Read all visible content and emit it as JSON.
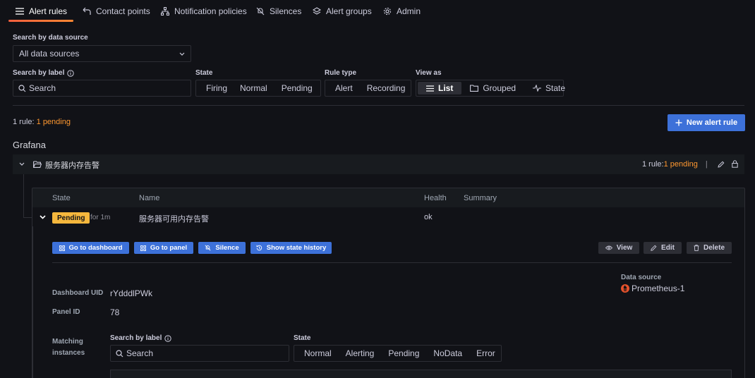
{
  "tabs": [
    {
      "label": "Alert rules",
      "icon": "list-icon",
      "active": true
    },
    {
      "label": "Contact points",
      "icon": "comment-icon"
    },
    {
      "label": "Notification policies",
      "icon": "sitemap-icon"
    },
    {
      "label": "Silences",
      "icon": "bell-slash-icon"
    },
    {
      "label": "Alert groups",
      "icon": "layers-icon"
    },
    {
      "label": "Admin",
      "icon": "cog-icon"
    }
  ],
  "filters": {
    "datasource_label": "Search by data source",
    "datasource_value": "All data sources",
    "label_search_label": "Search by label",
    "label_search_placeholder": "Search",
    "state_label": "State",
    "state_options": [
      "Firing",
      "Normal",
      "Pending"
    ],
    "ruletype_label": "Rule type",
    "ruletype_options": [
      "Alert",
      "Recording"
    ],
    "viewas_label": "View as",
    "viewas_options": [
      "List",
      "Grouped",
      "State"
    ],
    "viewas_selected": "List"
  },
  "summary": {
    "prefix": "1 rule: ",
    "pending": "1 pending"
  },
  "new_rule_button": "New alert rule",
  "namespace": "Grafana",
  "folder": {
    "name": "服务器内存告警",
    "summary_prefix": "1 rule: ",
    "summary_pending": "1 pending",
    "separator": "|"
  },
  "table": {
    "headers": {
      "state": "State",
      "name": "Name",
      "health": "Health",
      "summary": "Summary"
    },
    "row": {
      "state": "Pending",
      "for": "for 1m",
      "name": "服务器可用内存告警",
      "health": "ok",
      "summary": ""
    }
  },
  "actions": {
    "go_dashboard": "Go to dashboard",
    "go_panel": "Go to panel",
    "silence": "Silence",
    "history": "Show state history",
    "view": "View",
    "edit": "Edit",
    "delete": "Delete"
  },
  "details": {
    "dashboard_uid_label": "Dashboard UID",
    "dashboard_uid": "rYdddlPWk",
    "panel_id_label": "Panel ID",
    "panel_id": "78",
    "datasource_label": "Data source",
    "datasource": "Prometheus-1"
  },
  "instances": {
    "label_line1": "Matching",
    "label_line2": "instances",
    "search_label": "Search by label",
    "search_placeholder": "Search",
    "state_label": "State",
    "state_options": [
      "Normal",
      "Alerting",
      "Pending",
      "NoData",
      "Error"
    ]
  },
  "colors": {
    "primary": "#3d71d9",
    "pending": "#f5b73d",
    "pending_text": "#ff9830",
    "prometheus": "#e6522c"
  }
}
